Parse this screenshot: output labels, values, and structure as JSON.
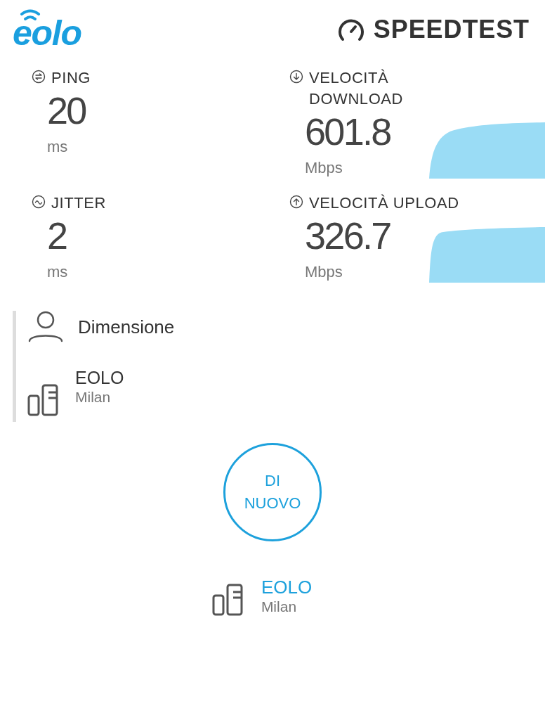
{
  "header": {
    "logo": "eolo",
    "brand": "SPEEDTEST"
  },
  "metrics": [
    {
      "kind": "ping",
      "label": "PING",
      "value": "20",
      "unit": "ms"
    },
    {
      "kind": "download",
      "label": "VELOCITÀ DOWNLOAD",
      "value": "601.8",
      "unit": "Mbps"
    },
    {
      "kind": "jitter",
      "label": "JITTER",
      "value": "2",
      "unit": "ms"
    },
    {
      "kind": "upload",
      "label": "VELOCITÀ UPLOAD",
      "value": "326.7",
      "unit": "Mbps"
    }
  ],
  "provider": {
    "name": "Dimensione"
  },
  "server": {
    "name": "EOLO",
    "location": "Milan"
  },
  "action": {
    "label": "DI NUOVO"
  },
  "footer_server": {
    "name": "EOLO",
    "location": "Milan"
  }
}
